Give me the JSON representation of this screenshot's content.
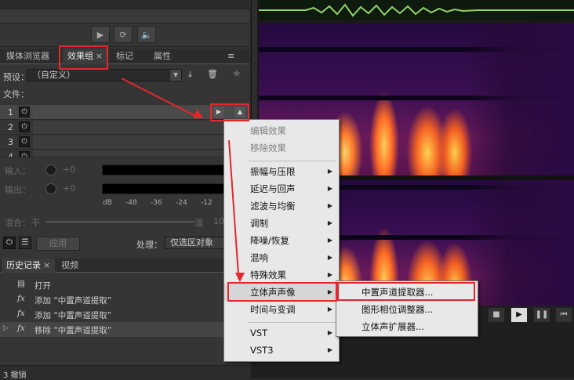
{
  "panel_tabs": {
    "media_browser": "媒体浏览器",
    "effects_rack": "效果组",
    "effects_rack_close": "×",
    "markers": "标记",
    "properties": "属性"
  },
  "effects_rack": {
    "preset_label": "预设：",
    "preset_value": "（自定义）",
    "file_label": "文件：",
    "slots": [
      "1",
      "2",
      "3",
      "4"
    ],
    "input_label": "输入：",
    "input_value": "+0",
    "output_label": "输出：",
    "output_value": "+0",
    "meter_scale": [
      "dB",
      "-48",
      "-36",
      "-24",
      "-12"
    ],
    "mix_label": "混合：",
    "mix_dry": "干",
    "mix_wet": "湿",
    "mix_value": "10",
    "apply_label": "应用",
    "process_label": "处理：",
    "process_value": "仅选区对象"
  },
  "history": {
    "tab_history": "历史记录",
    "tab_history_close": "×",
    "tab_video": "视频",
    "items": [
      {
        "icon": "",
        "text": "打开"
      },
      {
        "icon": "fx",
        "text": "添加 “中置声道提取”"
      },
      {
        "icon": "fx",
        "text": "添加 “中置声道提取”"
      },
      {
        "icon": "fx",
        "text": "移除 “中置声道提取”"
      }
    ],
    "undo_count": "3 撤销"
  },
  "context_menu": {
    "items": [
      {
        "label": "编辑效果",
        "disabled": true
      },
      {
        "label": "移除效果",
        "disabled": true
      },
      {
        "label": "振幅与压限",
        "sub": true
      },
      {
        "label": "延迟与回声",
        "sub": true
      },
      {
        "label": "滤波与均衡",
        "sub": true
      },
      {
        "label": "调制",
        "sub": true
      },
      {
        "label": "降噪/恢复",
        "sub": true
      },
      {
        "label": "混响",
        "sub": true
      },
      {
        "label": "特殊效果",
        "sub": true
      },
      {
        "label": "立体声声像",
        "sub": true
      },
      {
        "label": "时间与变调",
        "sub": true
      },
      {
        "label": "VST",
        "sub": true
      },
      {
        "label": "VST3",
        "sub": true
      }
    ]
  },
  "submenu": {
    "items": [
      "中置声道提取器...",
      "图形相位调整器...",
      "立体声扩展器..."
    ]
  },
  "colors": {
    "highlight": "#e3282e",
    "menu_bg": "#e8e8e8"
  }
}
